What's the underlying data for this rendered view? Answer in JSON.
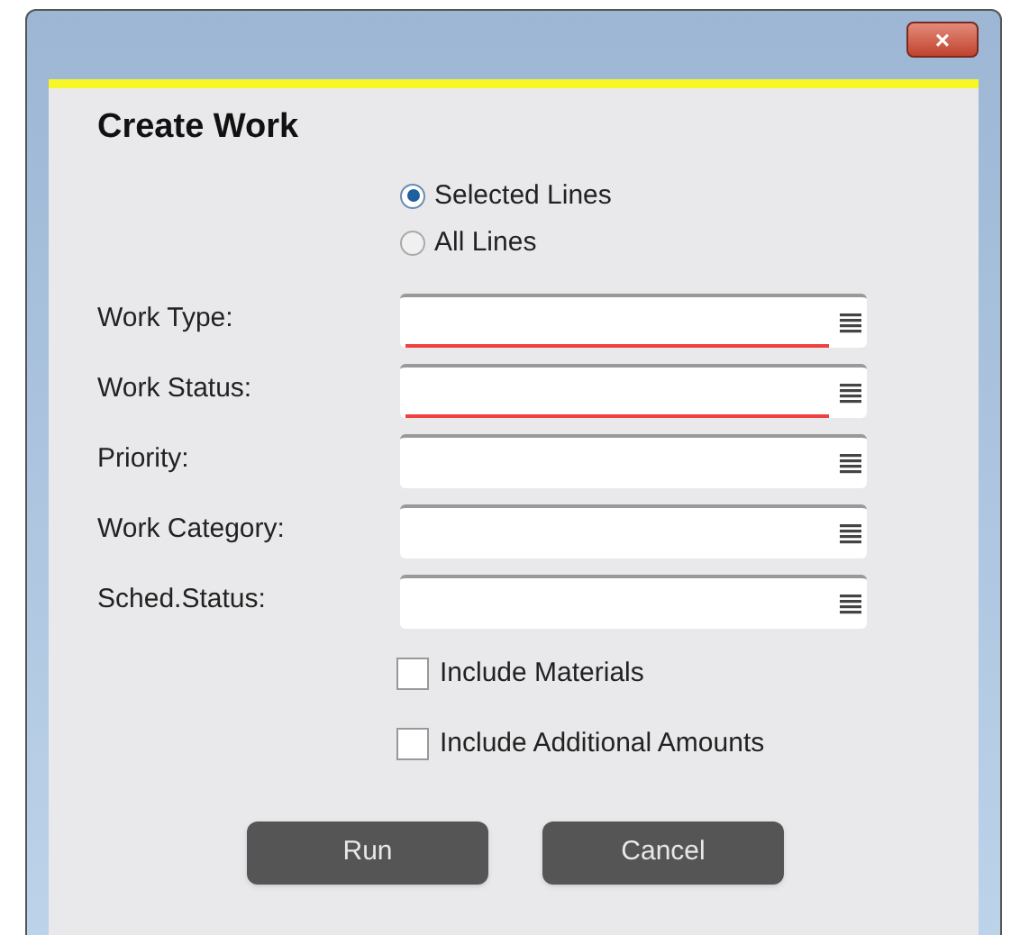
{
  "window": {
    "title": "Create Work",
    "close": "×"
  },
  "scope": [
    {
      "label": "Selected Lines",
      "selected": true
    },
    {
      "label": "All Lines",
      "selected": false
    }
  ],
  "fields": [
    {
      "label": "Work Type:",
      "required": true
    },
    {
      "label": "Work Status:",
      "required": true
    },
    {
      "label": "Priority:",
      "required": false
    },
    {
      "label": "Work Category:",
      "required": false
    },
    {
      "label": "Sched.Status:",
      "required": false
    }
  ],
  "options": [
    {
      "label": "Include Materials",
      "checked": false
    },
    {
      "label": "Include Additional Amounts",
      "checked": false
    }
  ],
  "buttons": [
    "Run",
    "Cancel"
  ]
}
